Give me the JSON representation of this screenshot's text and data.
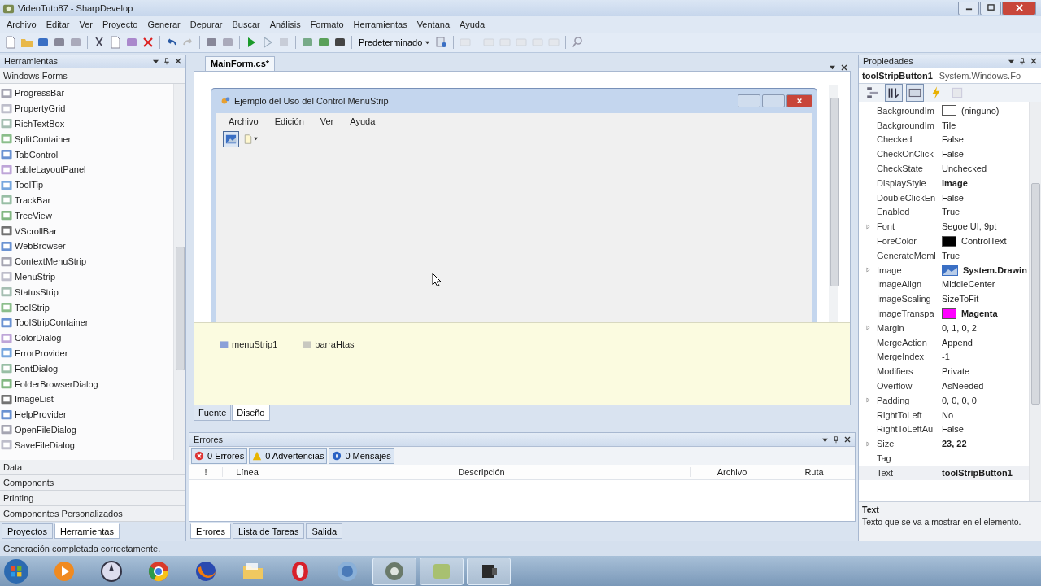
{
  "window": {
    "title": "VideoTuto87 - SharpDevelop"
  },
  "menu": [
    "Archivo",
    "Editar",
    "Ver",
    "Proyecto",
    "Generar",
    "Depurar",
    "Buscar",
    "Análisis",
    "Formato",
    "Herramientas",
    "Ventana",
    "Ayuda"
  ],
  "toolbar": {
    "configuration": "Predeterminado"
  },
  "toolbox": {
    "title": "Herramientas",
    "category": "Windows Forms",
    "items": [
      "ProgressBar",
      "PropertyGrid",
      "RichTextBox",
      "SplitContainer",
      "TabControl",
      "TableLayoutPanel",
      "ToolTip",
      "TrackBar",
      "TreeView",
      "VScrollBar",
      "WebBrowser",
      "ContextMenuStrip",
      "MenuStrip",
      "StatusStrip",
      "ToolStrip",
      "ToolStripContainer",
      "ColorDialog",
      "ErrorProvider",
      "FontDialog",
      "FolderBrowserDialog",
      "ImageList",
      "HelpProvider",
      "OpenFileDialog",
      "SaveFileDialog"
    ],
    "categories": [
      "Data",
      "Components",
      "Printing",
      "Componentes Personalizados"
    ],
    "tabs": [
      {
        "label": "Proyectos",
        "selected": false
      },
      {
        "label": "Herramientas",
        "selected": true
      }
    ]
  },
  "editor": {
    "document_tab": "MainForm.cs*",
    "form": {
      "title": "Ejemplo del Uso del Control MenuStrip",
      "menu": [
        "Archivo",
        "Edición",
        "Ver",
        "Ayuda"
      ]
    },
    "tray": [
      "menuStrip1",
      "barraHtas"
    ],
    "view_tabs": [
      {
        "label": "Fuente",
        "selected": false
      },
      {
        "label": "Diseño",
        "selected": true
      }
    ]
  },
  "errors": {
    "title": "Errores",
    "filters": [
      {
        "kind": "error",
        "label": "0 Errores"
      },
      {
        "kind": "warning",
        "label": "0 Advertencias"
      },
      {
        "kind": "info",
        "label": "0 Mensajes"
      }
    ],
    "columns": [
      "!",
      "Línea",
      "Descripción",
      "Archivo",
      "Ruta"
    ],
    "tabs": [
      {
        "label": "Errores",
        "selected": true
      },
      {
        "label": "Lista de Tareas",
        "selected": false
      },
      {
        "label": "Salida",
        "selected": false
      }
    ]
  },
  "properties": {
    "title": "Propiedades",
    "object_name": "toolStripButton1",
    "object_type": "System.Windows.Fo",
    "rows": [
      {
        "name": "BackgroundIm",
        "value": "(ninguno)",
        "expandable": false,
        "modified": false,
        "selected": false,
        "swatch": {
          "kind": "color",
          "color": "#ffffff"
        }
      },
      {
        "name": "BackgroundIm",
        "value": "Tile",
        "expandable": false,
        "modified": false,
        "selected": false
      },
      {
        "name": "Checked",
        "value": "False",
        "expandable": false,
        "modified": false,
        "selected": false
      },
      {
        "name": "CheckOnClick",
        "value": "False",
        "expandable": false,
        "modified": false,
        "selected": false
      },
      {
        "name": "CheckState",
        "value": "Unchecked",
        "expandable": false,
        "modified": false,
        "selected": false
      },
      {
        "name": "DisplayStyle",
        "value": "Image",
        "expandable": false,
        "modified": true,
        "selected": false
      },
      {
        "name": "DoubleClickEn",
        "value": "False",
        "expandable": false,
        "modified": false,
        "selected": false
      },
      {
        "name": "Enabled",
        "value": "True",
        "expandable": false,
        "modified": false,
        "selected": false
      },
      {
        "name": "Font",
        "value": "Segoe UI, 9pt",
        "expandable": true,
        "modified": false,
        "selected": false
      },
      {
        "name": "ForeColor",
        "value": "ControlText",
        "expandable": false,
        "modified": false,
        "selected": false,
        "swatch": {
          "kind": "color",
          "color": "#000000"
        }
      },
      {
        "name": "GenerateMeml",
        "value": "True",
        "expandable": false,
        "modified": false,
        "selected": false
      },
      {
        "name": "Image",
        "value": "System.Drawin",
        "expandable": true,
        "modified": true,
        "selected": false,
        "swatch": {
          "kind": "image"
        }
      },
      {
        "name": "ImageAlign",
        "value": "MiddleCenter",
        "expandable": false,
        "modified": false,
        "selected": false
      },
      {
        "name": "ImageScaling",
        "value": "SizeToFit",
        "expandable": false,
        "modified": false,
        "selected": false
      },
      {
        "name": "ImageTranspa",
        "value": "Magenta",
        "expandable": false,
        "modified": true,
        "selected": false,
        "swatch": {
          "kind": "color",
          "color": "#ff00ff"
        }
      },
      {
        "name": "Margin",
        "value": "0, 1, 0, 2",
        "expandable": true,
        "modified": false,
        "selected": false
      },
      {
        "name": "MergeAction",
        "value": "Append",
        "expandable": false,
        "modified": false,
        "selected": false
      },
      {
        "name": "MergeIndex",
        "value": "-1",
        "expandable": false,
        "modified": false,
        "selected": false
      },
      {
        "name": "Modifiers",
        "value": "Private",
        "expandable": false,
        "modified": false,
        "selected": false
      },
      {
        "name": "Overflow",
        "value": "AsNeeded",
        "expandable": false,
        "modified": false,
        "selected": false
      },
      {
        "name": "Padding",
        "value": "0, 0, 0, 0",
        "expandable": true,
        "modified": false,
        "selected": false
      },
      {
        "name": "RightToLeft",
        "value": "No",
        "expandable": false,
        "modified": false,
        "selected": false
      },
      {
        "name": "RightToLeftAu",
        "value": "False",
        "expandable": false,
        "modified": false,
        "selected": false
      },
      {
        "name": "Size",
        "value": "23, 22",
        "expandable": true,
        "modified": true,
        "selected": false
      },
      {
        "name": "Tag",
        "expandable": false,
        "selected": false
      },
      {
        "name": "Text",
        "value": "toolStripButton1",
        "expandable": false,
        "modified": true,
        "selected": true
      }
    ],
    "description": {
      "title": "Text",
      "text": "Texto que se va a mostrar en el elemento."
    }
  },
  "status_bar": {
    "message": "Generación completada correctamente."
  }
}
